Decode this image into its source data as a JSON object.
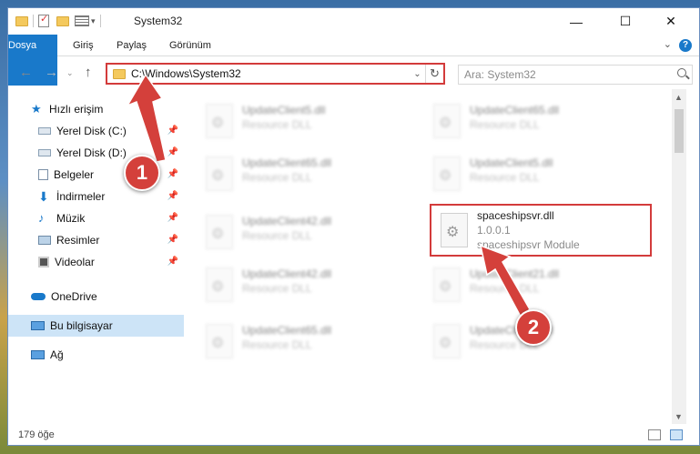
{
  "window": {
    "title": "System32",
    "controls": {
      "minimize": "—",
      "maximize": "☐",
      "close": "✕"
    }
  },
  "ribbon": {
    "tabs": [
      "Dosya",
      "Giriş",
      "Paylaş",
      "Görünüm"
    ],
    "help_label": "?"
  },
  "nav": {
    "address": "C:\\Windows\\System32",
    "search_placeholder": "Ara: System32"
  },
  "sidebar": {
    "items": [
      {
        "label": "Hızlı erişim",
        "icon": "star-icon"
      },
      {
        "label": "Yerel Disk (C:)",
        "icon": "drive-icon",
        "pinned": true
      },
      {
        "label": "Yerel Disk (D:)",
        "icon": "drive-icon",
        "pinned": true
      },
      {
        "label": "Belgeler",
        "icon": "documents-icon",
        "pinned": true
      },
      {
        "label": "İndirmeler",
        "icon": "download-icon",
        "pinned": true
      },
      {
        "label": "Müzik",
        "icon": "music-icon",
        "pinned": true
      },
      {
        "label": "Resimler",
        "icon": "pictures-icon",
        "pinned": true
      },
      {
        "label": "Videolar",
        "icon": "videos-icon",
        "pinned": true
      },
      {
        "label": "OneDrive",
        "icon": "cloud-icon"
      },
      {
        "label": "Bu bilgisayar",
        "icon": "computer-icon",
        "selected": true
      },
      {
        "label": "Ağ",
        "icon": "network-icon"
      }
    ]
  },
  "files": {
    "left": [
      {
        "name": "UpdateClient5.dll",
        "desc": "Resource DLL"
      },
      {
        "name": "UpdateClient65.dll",
        "desc": "Resource DLL"
      },
      {
        "name": "UpdateClient42.dll",
        "desc": "Resource DLL"
      },
      {
        "name": "UpdateClient42.dll",
        "desc": "Resource DLL"
      },
      {
        "name": "UpdateClient65.dll",
        "desc": "Resource DLL"
      }
    ],
    "right": [
      {
        "name": "UpdateClient65.dll",
        "desc": "Resource DLL"
      },
      {
        "name": "UpdateClient5.dll",
        "desc": "Resource DLL"
      },
      {
        "name": "UpdateClient21.dll",
        "desc": "Resource DLL"
      },
      {
        "name": "UpdateClient5.dll",
        "desc": "Resource DLL"
      }
    ],
    "highlighted": {
      "name": "spaceshipsvr.dll",
      "version": "1.0.0.1",
      "desc": "spaceshipsvr Module"
    }
  },
  "status": {
    "count": "179 öğe"
  },
  "annotations": {
    "step1": "1",
    "step2": "2",
    "color": "#d4403b"
  }
}
